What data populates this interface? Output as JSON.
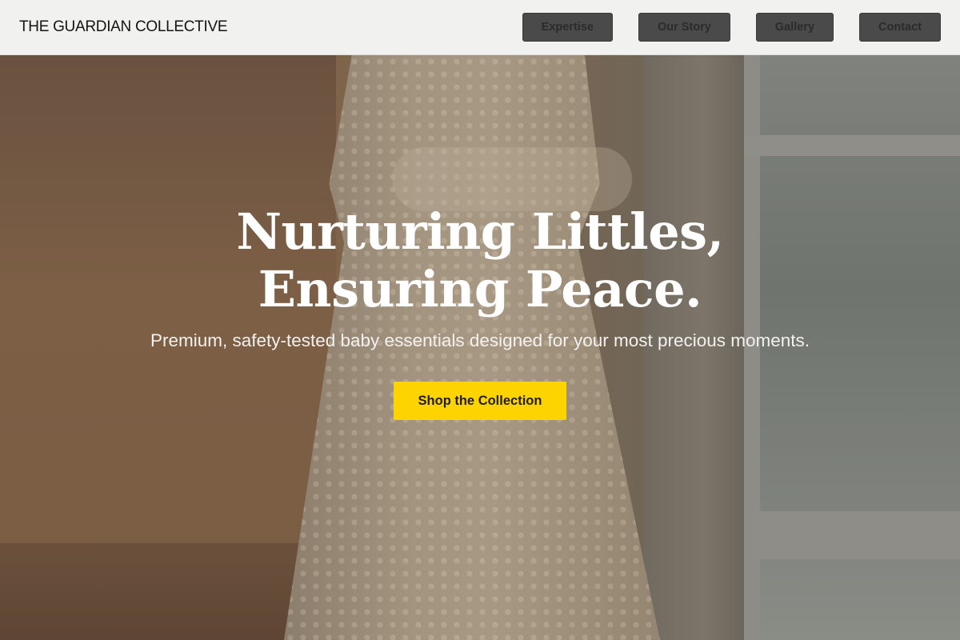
{
  "header": {
    "brand": "THE GUARDIAN COLLECTIVE",
    "nav": [
      {
        "label": "Expertise"
      },
      {
        "label": "Our Story"
      },
      {
        "label": "Gallery"
      },
      {
        "label": "Contact"
      }
    ]
  },
  "hero": {
    "title_line1": "Nurturing Littles,",
    "title_line2": "Ensuring Peace.",
    "subtitle": "Premium, safety-tested baby essentials designed for your most precious moments.",
    "cta_label": "Shop the Collection",
    "background_image": "baby-dress-hanging-by-window"
  },
  "colors": {
    "header_bg": "#f1f1f0",
    "nav_button_bg": "#4a4a4a",
    "cta_bg": "#fed400",
    "hero_text": "#ffffff"
  }
}
